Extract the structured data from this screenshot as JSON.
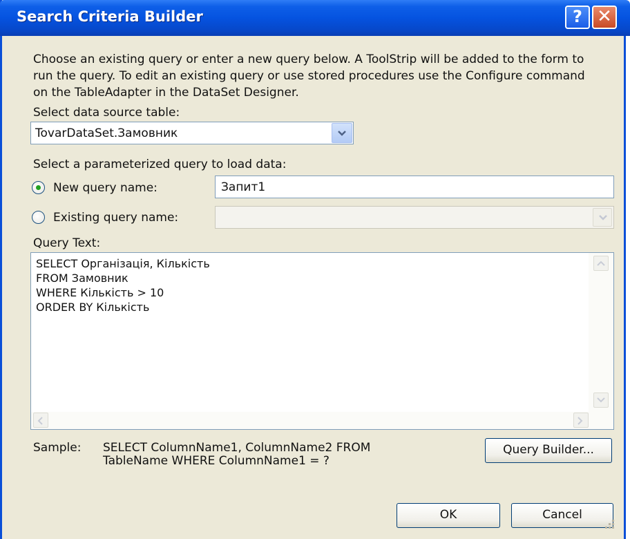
{
  "window": {
    "title": "Search Criteria Builder",
    "help_glyph": "?",
    "close_glyph": "✕"
  },
  "description": "Choose an existing query or enter a new query below. A ToolStrip will be added to the form to run the query. To edit an existing query or use stored procedures use the Configure command on the TableAdapter in the DataSet Designer.",
  "datasource": {
    "label": "Select data source table:",
    "value": "TovarDataSet.Замовник"
  },
  "query_select": {
    "label": "Select a parameterized query to load data:",
    "new_label": "New query name:",
    "new_value": "Запит1",
    "new_selected": true,
    "existing_label": "Existing query name:",
    "existing_value": ""
  },
  "query_text": {
    "label": "Query Text:",
    "lines": [
      "SELECT  Організація, Кількість",
      "FROM  Замовник",
      "WHERE Кількість > 10",
      "ORDER BY  Кількість"
    ]
  },
  "sample": {
    "label": "Sample:",
    "line1": "SELECT ColumnName1, ColumnName2 FROM",
    "line2": "TableName WHERE ColumnName1 = ?"
  },
  "buttons": {
    "query_builder": "Query Builder...",
    "ok": "OK",
    "cancel": "Cancel"
  },
  "colors": {
    "titlebar": "#0553e0",
    "dialog_bg": "#ece9d8",
    "radio_selected": "#21a121",
    "border": "#7f9db9"
  },
  "icons": {
    "help": "help-icon",
    "close": "close-icon",
    "dropdown": "chevron-down-icon"
  }
}
